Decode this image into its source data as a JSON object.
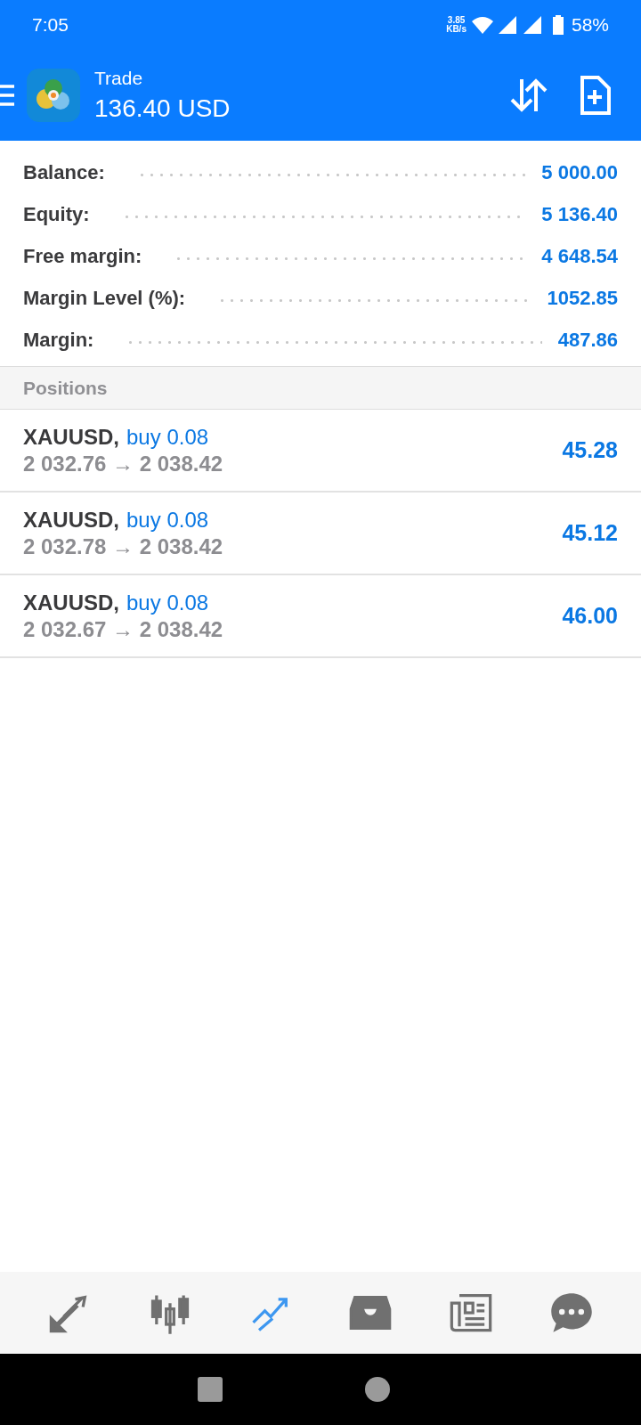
{
  "status_bar": {
    "time": "7:05",
    "speed_value": "3.85",
    "speed_unit": "KB/s",
    "battery": "58%"
  },
  "header": {
    "title": "Trade",
    "subtitle": "136.40 USD"
  },
  "summary": [
    {
      "label": "Balance:",
      "value": "5 000.00"
    },
    {
      "label": "Equity:",
      "value": "5 136.40"
    },
    {
      "label": "Free margin:",
      "value": "4 648.54"
    },
    {
      "label": "Margin Level (%):",
      "value": "1052.85"
    },
    {
      "label": "Margin:",
      "value": "487.86"
    }
  ],
  "positions": {
    "title": "Positions",
    "rows": [
      {
        "symbol": "XAUUSD,",
        "order": "buy 0.08",
        "prices": "2 032.76 → 2 038.42",
        "profit": "45.28"
      },
      {
        "symbol": "XAUUSD,",
        "order": "buy 0.08",
        "prices": "2 032.78 → 2 038.42",
        "profit": "45.12"
      },
      {
        "symbol": "XAUUSD,",
        "order": "buy 0.08",
        "prices": "2 032.67 → 2 038.42",
        "profit": "46.00"
      }
    ]
  },
  "bottom_nav": [
    {
      "kind": "quotes",
      "selected": false
    },
    {
      "kind": "chart",
      "selected": false
    },
    {
      "kind": "trade",
      "selected": true
    },
    {
      "kind": "history",
      "selected": false
    },
    {
      "kind": "news",
      "selected": false
    },
    {
      "kind": "chat",
      "selected": false
    }
  ]
}
